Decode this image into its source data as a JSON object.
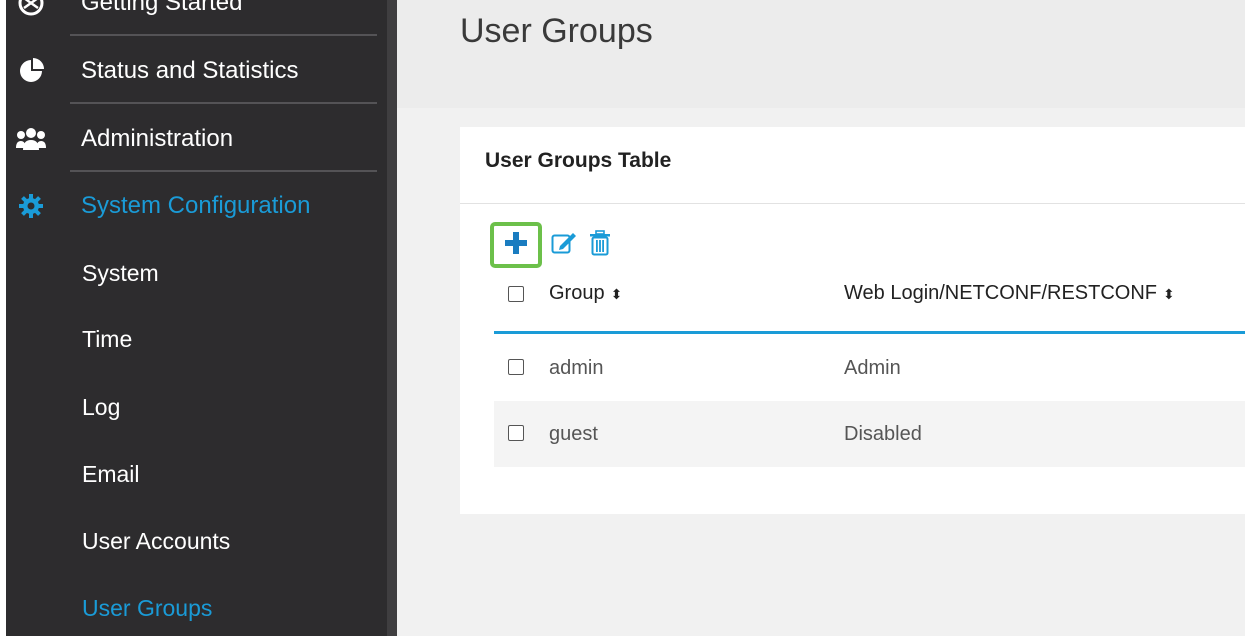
{
  "sidebar": {
    "items": [
      {
        "label": "Getting Started",
        "icon": "getting-started-icon"
      },
      {
        "label": "Status and Statistics",
        "icon": "pie-chart-icon"
      },
      {
        "label": "Administration",
        "icon": "users-icon"
      },
      {
        "label": "System Configuration",
        "icon": "gear-icon"
      }
    ],
    "sub_items": [
      "System",
      "Time",
      "Log",
      "Email",
      "User Accounts",
      "User Groups"
    ]
  },
  "page": {
    "title": "User Groups"
  },
  "panel": {
    "title": "User Groups Table",
    "toolbar": {
      "add_icon": "plus-icon",
      "edit_icon": "edit-icon",
      "delete_icon": "trash-icon"
    },
    "columns": [
      "Group",
      "Web Login/NETCONF/RESTCONF"
    ],
    "rows": [
      {
        "group": "admin",
        "web_login": "Admin"
      },
      {
        "group": "guest",
        "web_login": "Disabled"
      }
    ]
  },
  "colors": {
    "accent": "#1a9bd7",
    "highlight": "#6cc04a",
    "sidebar_bg": "#2d2c2e"
  }
}
